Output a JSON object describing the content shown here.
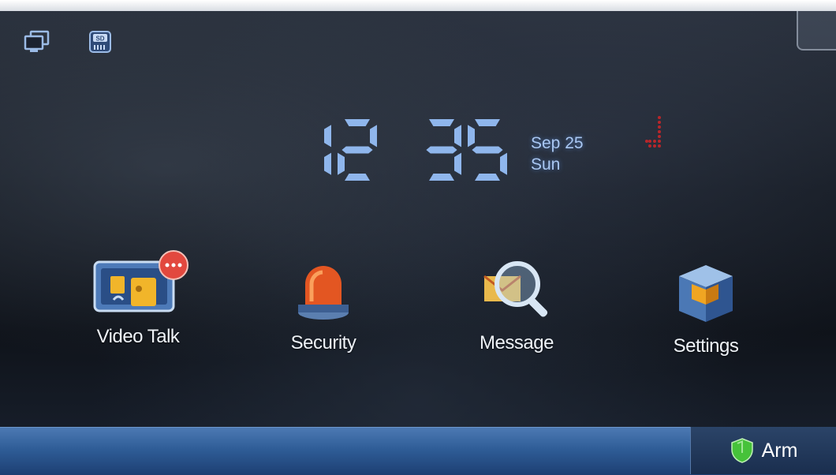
{
  "clock": {
    "hours": "12",
    "minutes": "35",
    "date": "Sep 25",
    "weekday": "Sun"
  },
  "status_bar": {
    "icons": [
      "monitor-icon",
      "sd-card-icon"
    ],
    "sd_label": "SD"
  },
  "apps": [
    {
      "label": "Video Talk",
      "icon": "video-talk-icon"
    },
    {
      "label": "Security",
      "icon": "alarm-light-icon"
    },
    {
      "label": "Message",
      "icon": "message-search-icon"
    },
    {
      "label": "Settings",
      "icon": "cubes-icon"
    }
  ],
  "taskbar": {
    "arm_label": "Arm",
    "arm_icon": "shield-icon"
  },
  "colors": {
    "clock": "#8fb6ec",
    "taskbar": "#2f5d97",
    "shield": "#46c23a"
  }
}
